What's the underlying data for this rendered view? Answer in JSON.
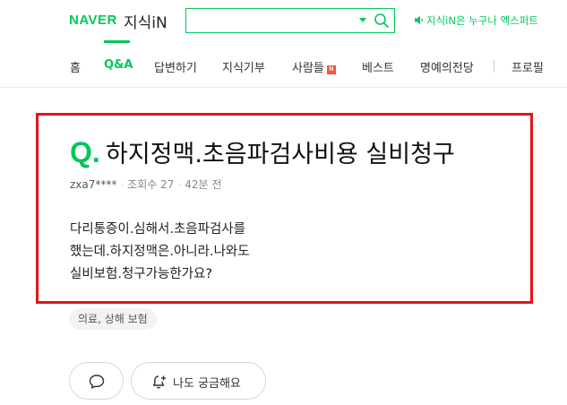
{
  "header": {
    "brand": "NAVER",
    "service": "지식iN",
    "search_value": "",
    "promo_text": "지식iN은 누구나 엑스퍼트"
  },
  "nav": {
    "items": [
      {
        "label": "홈"
      },
      {
        "label": "Q&A",
        "active": true
      },
      {
        "label": "답변하기"
      },
      {
        "label": "지식기부"
      },
      {
        "label": "사람들",
        "badge": "N"
      },
      {
        "label": "베스트"
      },
      {
        "label": "명예의전당"
      },
      {
        "label": "프로필"
      }
    ]
  },
  "question": {
    "q_mark": "Q.",
    "title": "하지정맥.초음파검사비용 실비청구",
    "author": "zxa7****",
    "views": "조회수 27",
    "time": "42분 전",
    "body_lines": [
      "다리통증이.심해서.초음파검사를",
      "했는데.하지정맥은.아니라.나와도",
      "실비보험.청구가능한가요?"
    ],
    "tag": "의료, 상해 보험"
  },
  "actions": {
    "curious_label": "나도 궁금해요"
  },
  "colors": {
    "brand_green": "#03c75a",
    "highlight_red": "#e3141b",
    "badge_red": "#f5533d"
  },
  "icons": [
    "search-icon",
    "dropdown-icon",
    "speaker-icon",
    "comment-icon",
    "bell-plus-icon"
  ]
}
